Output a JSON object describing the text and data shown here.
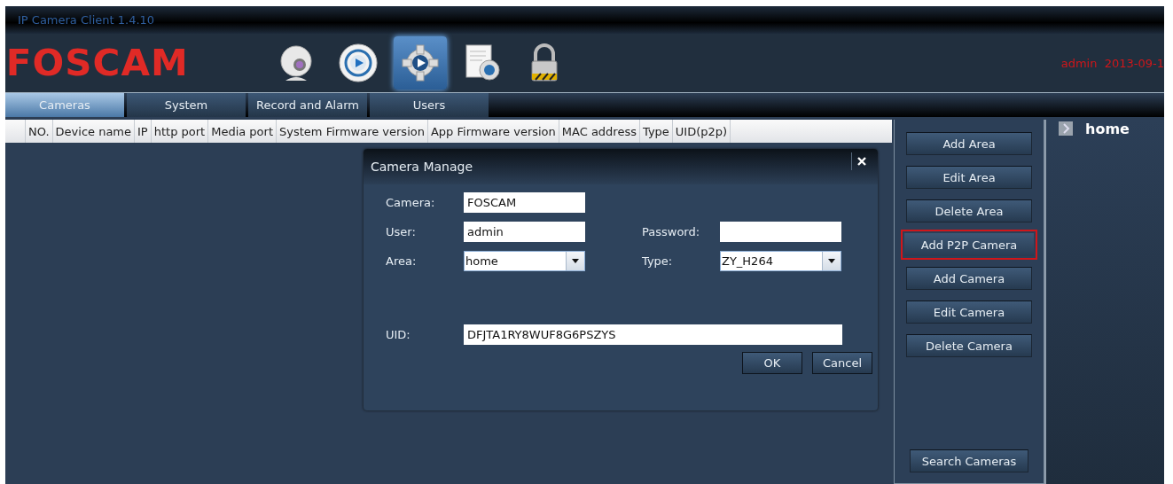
{
  "window": {
    "title": "IP Camera Client 1.4.10"
  },
  "logo": "FOSCAM",
  "toolbar": [
    {
      "kind": "webcam",
      "selected": false
    },
    {
      "kind": "play",
      "selected": false
    },
    {
      "kind": "gear",
      "selected": true
    },
    {
      "kind": "document",
      "selected": false
    },
    {
      "kind": "lock",
      "selected": false
    }
  ],
  "user_info": "admin  2013-09-1",
  "tabs": [
    {
      "label": "Cameras",
      "selected": true
    },
    {
      "label": "System",
      "selected": false
    },
    {
      "label": "Record and Alarm",
      "selected": false
    },
    {
      "label": "Users",
      "selected": false
    }
  ],
  "table": {
    "columns": [
      "NO.",
      "Device name",
      "IP",
      "http port",
      "Media port",
      "System Firmware version",
      "App Firmware version",
      "MAC address",
      "Type",
      "UID(p2p)"
    ]
  },
  "dialog": {
    "title": "Camera Manage",
    "rows": [
      [
        {
          "kind": "text",
          "label": "Camera:",
          "value": "FOSCAM"
        }
      ],
      [
        {
          "kind": "text",
          "label": "User:",
          "value": "admin"
        },
        {
          "kind": "password",
          "label": "Password:"
        }
      ],
      [
        {
          "kind": "select",
          "label": "Area:",
          "value": "home"
        },
        {
          "kind": "select",
          "label": "Type:",
          "value": "ZY_H264"
        }
      ],
      [
        {
          "kind": "text",
          "label": "UID:",
          "value": "DFJTA1RY8WUF8G6PSZYS"
        }
      ]
    ],
    "buttons": [
      "OK",
      "Cancel"
    ]
  },
  "actions": [
    {
      "label": "Add Area",
      "highlighted": false
    },
    {
      "label": "Edit Area",
      "highlighted": false
    },
    {
      "label": "Delete Area",
      "highlighted": false
    },
    {
      "label": "Add P2P Camera",
      "highlighted": true
    },
    {
      "label": "Add Camera",
      "highlighted": false
    },
    {
      "label": "Edit Camera",
      "highlighted": false
    },
    {
      "label": "Delete Camera",
      "highlighted": false
    }
  ],
  "search_button": "Search Cameras",
  "tree": {
    "items": [
      {
        "label": "home"
      }
    ]
  }
}
